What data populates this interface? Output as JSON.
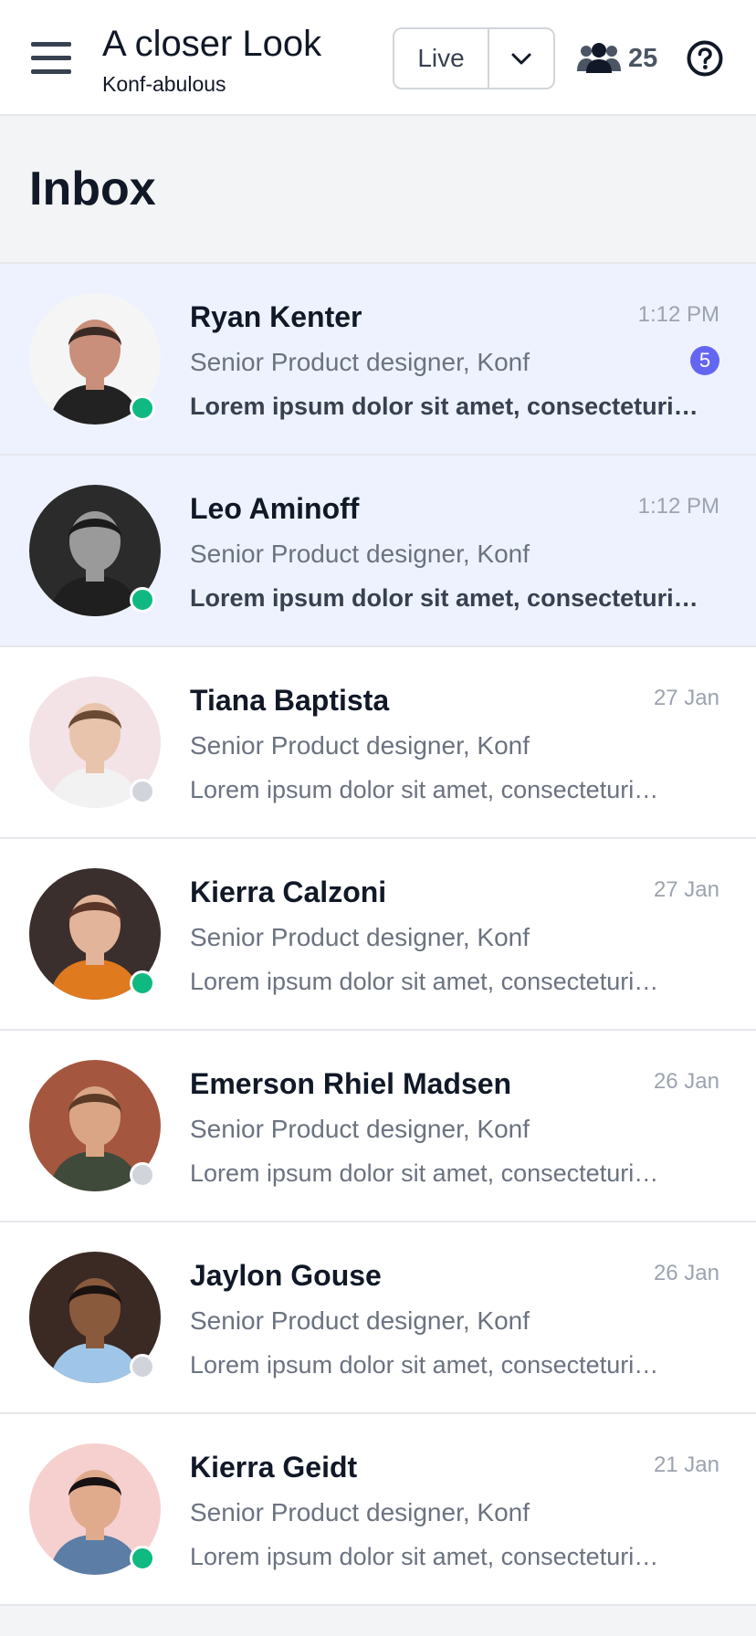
{
  "header": {
    "title": "A closer Look",
    "subtitle": "Konf-abulous",
    "live_label": "Live",
    "attendee_count": "25",
    "menu_icon": "hamburger-icon",
    "attendees_icon": "users-icon",
    "help_icon": "question-circle-icon",
    "dropdown_icon": "chevron-down-icon"
  },
  "inbox": {
    "title": "Inbox"
  },
  "colors": {
    "online": "#10b981",
    "offline": "#d1d5db",
    "badge": "#6366f1",
    "unread_bg": "#eef2ff"
  },
  "messages": [
    {
      "name": "Ryan Kenter",
      "role": "Senior Product designer, Konf",
      "preview": "Lorem ipsum dolor sit amet, consecteturi…",
      "time": "1:12 PM",
      "unread": true,
      "badge": "5",
      "online": true
    },
    {
      "name": "Leo Aminoff",
      "role": "Senior Product designer, Konf",
      "preview": "Lorem ipsum dolor sit amet, consecteturi…",
      "time": "1:12 PM",
      "unread": true,
      "badge": "",
      "online": true
    },
    {
      "name": "Tiana Baptista",
      "role": "Senior Product designer, Konf",
      "preview": "Lorem ipsum dolor sit amet, consecteturi…",
      "time": "27 Jan",
      "unread": false,
      "badge": "",
      "online": false
    },
    {
      "name": "Kierra Calzoni",
      "role": "Senior Product designer, Konf",
      "preview": "Lorem ipsum dolor sit amet, consecteturi…",
      "time": "27 Jan",
      "unread": false,
      "badge": "",
      "online": true
    },
    {
      "name": "Emerson Rhiel Madsen",
      "role": "Senior Product designer, Konf",
      "preview": "Lorem ipsum dolor sit amet, consecteturi…",
      "time": "26 Jan",
      "unread": false,
      "badge": "",
      "online": false
    },
    {
      "name": "Jaylon Gouse",
      "role": "Senior Product designer, Konf",
      "preview": "Lorem ipsum dolor sit amet, consecteturi…",
      "time": "26 Jan",
      "unread": false,
      "badge": "",
      "online": false
    },
    {
      "name": "Kierra Geidt",
      "role": "Senior Product designer, Konf",
      "preview": "Lorem ipsum dolor sit amet, consecteturi…",
      "time": "21 Jan",
      "unread": false,
      "badge": "",
      "online": true
    }
  ]
}
